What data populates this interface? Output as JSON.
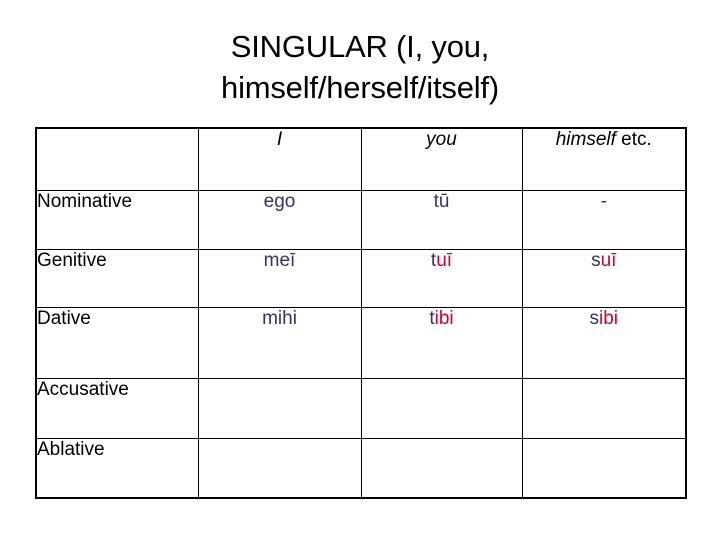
{
  "slide": {
    "title_line1": "SINGULAR (I, you,",
    "title_line2": "himself/herself/itself)",
    "colors": {
      "text": "#000000",
      "navy": "#333366",
      "red": "#cc0033",
      "border": "#000000",
      "background": "#ffffff"
    }
  },
  "table": {
    "headers": {
      "case_column": "",
      "first_person": "I",
      "second_person": "you",
      "third_person_italic": "himself",
      "third_person_plain": " etc."
    },
    "rows": [
      {
        "case": "Nominative",
        "first_person": {
          "navy": "ego",
          "red": ""
        },
        "second_person": {
          "navy": "tū",
          "red": ""
        },
        "third_person": {
          "navy": "-",
          "red": ""
        }
      },
      {
        "case": "Genitive",
        "first_person": {
          "navy": "meī",
          "red": ""
        },
        "second_person": {
          "navy": "t",
          "red": "uī"
        },
        "third_person": {
          "navy": "s",
          "red": "uī"
        }
      },
      {
        "case": "Dative",
        "first_person": {
          "navy": "mihi",
          "red": ""
        },
        "second_person": {
          "navy": "t",
          "red": "ibi"
        },
        "third_person": {
          "navy": "s",
          "red": "ibi"
        }
      },
      {
        "case": "Accusative",
        "first_person": {
          "navy": "",
          "red": ""
        },
        "second_person": {
          "navy": "",
          "red": ""
        },
        "third_person": {
          "navy": "",
          "red": ""
        }
      },
      {
        "case": "Ablative",
        "first_person": {
          "navy": "",
          "red": ""
        },
        "second_person": {
          "navy": "",
          "red": ""
        },
        "third_person": {
          "navy": "",
          "red": ""
        }
      }
    ]
  }
}
